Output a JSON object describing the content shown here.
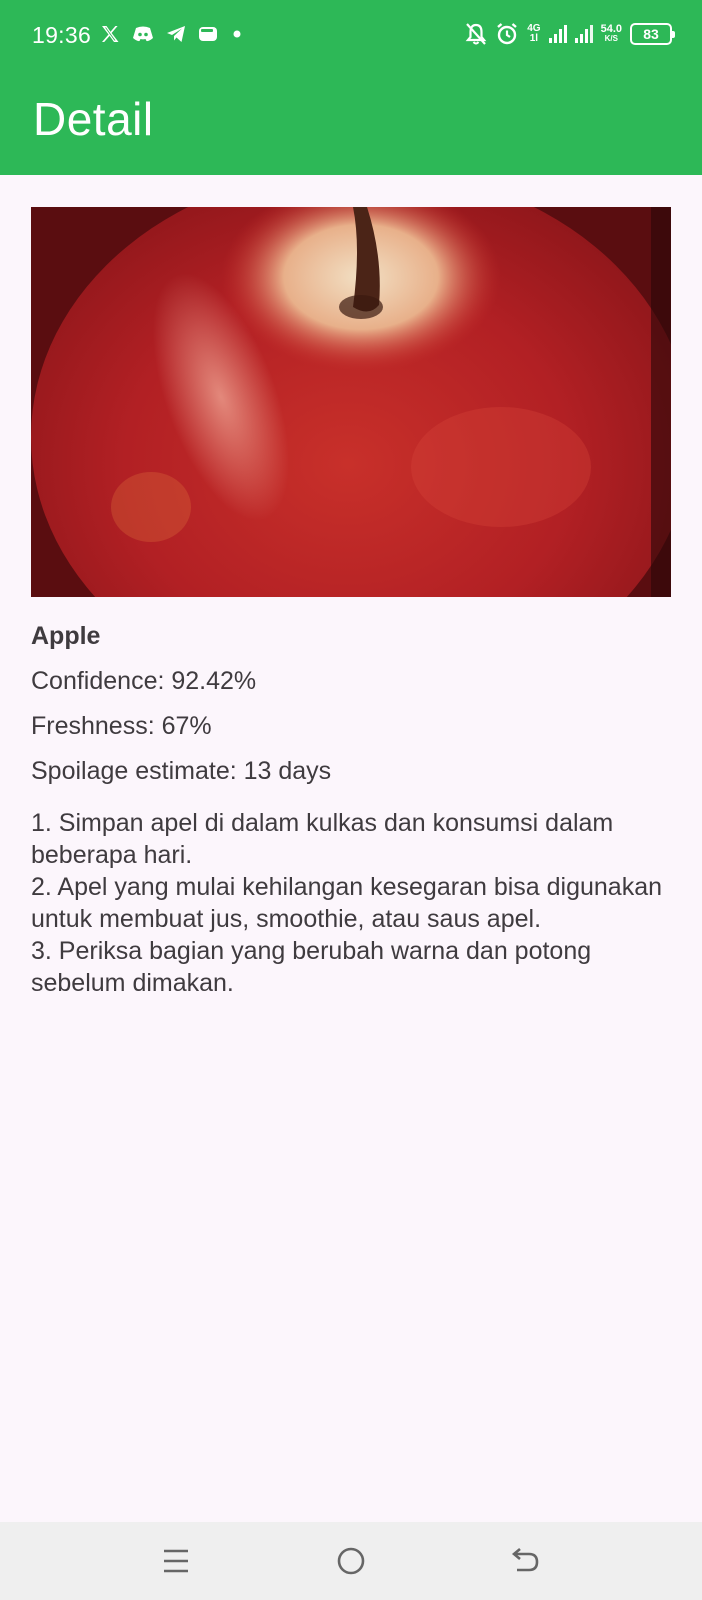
{
  "status_bar": {
    "time": "19:36",
    "left_icons": [
      "x-icon",
      "discord-icon",
      "telegram-icon",
      "wallet-icon",
      "dot-icon"
    ],
    "network_type": "4G",
    "network_sub": "1l",
    "speed_value": "54.0",
    "speed_unit": "K/S",
    "battery_level": "83"
  },
  "app_bar": {
    "title": "Detail"
  },
  "detail": {
    "image_subject": "apple-photo",
    "name": "Apple",
    "confidence": "Confidence: 92.42%",
    "freshness": "Freshness: 67%",
    "spoilage": "Spoilage estimate: 13 days",
    "tips": [
      "1. Simpan apel di dalam kulkas dan konsumsi dalam beberapa hari.",
      "2. Apel yang mulai kehilangan kesegaran bisa digunakan untuk membuat jus, smoothie, atau saus apel.",
      "3. Periksa bagian yang berubah warna dan potong sebelum dimakan."
    ]
  },
  "colors": {
    "primary": "#2db857",
    "background": "#fcf6fc",
    "text": "#3f3b3f",
    "nav_bar": "#efefef"
  },
  "nav_bar": {
    "buttons": [
      "menu-icon",
      "home-icon",
      "back-icon"
    ]
  }
}
